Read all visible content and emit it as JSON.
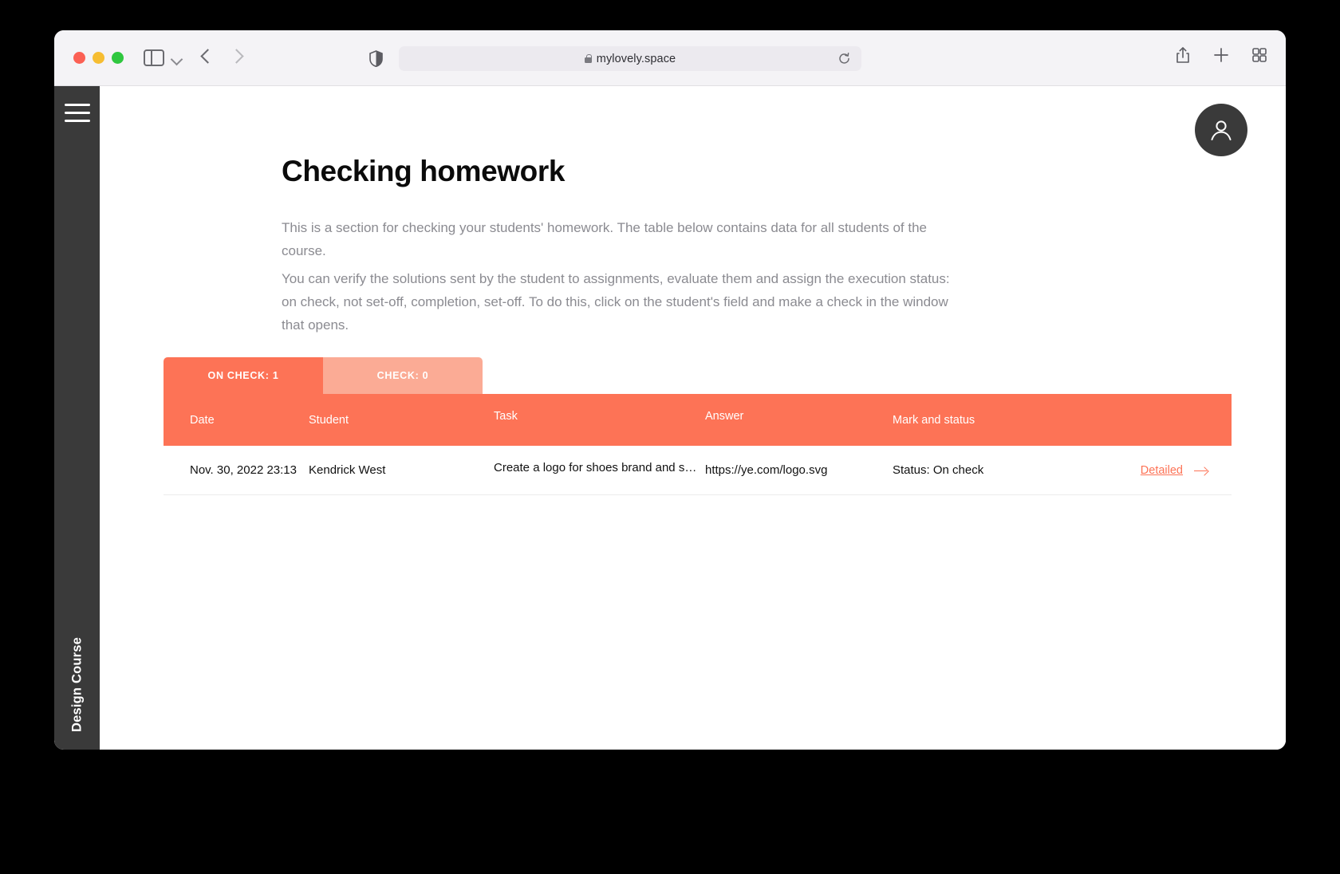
{
  "browser": {
    "url": "mylovely.space",
    "lock_icon": "lock-icon",
    "traffic_lights": [
      "close",
      "minimize",
      "zoom"
    ],
    "toolbar_icons": [
      "sidebar-icon",
      "chevron-down-icon",
      "back-arrow-icon",
      "forward-arrow-icon",
      "shield-icon",
      "reload-icon",
      "share-icon",
      "new-tab-icon",
      "tab-overview-icon"
    ]
  },
  "rail": {
    "menu_icon": "hamburger-menu-icon",
    "course_label": "Design Course"
  },
  "header": {
    "avatar_icon": "user-avatar-icon"
  },
  "main": {
    "title": "Checking homework",
    "paragraph_1": "This is a section for checking your students' homework. The table below contains data for all students of the course.",
    "paragraph_2": "You can verify the solutions sent by the student to assignments, evaluate them and assign the execution status: on check, not set-off, completion, set-off. To do this, click on the student's field and make a check in the window that opens."
  },
  "tabs": [
    {
      "label": "ON CHECK: 1",
      "active": true
    },
    {
      "label": "CHECK: 0",
      "active": false
    }
  ],
  "table": {
    "columns": [
      "Date",
      "Student",
      "Task",
      "Answer",
      "Mark and status",
      ""
    ],
    "rows": [
      {
        "date": "Nov. 30, 2022 23:13",
        "student": "Kendrick West",
        "task": "Create a logo for shoes brand and s…",
        "answer": "https://ye.com/logo.svg",
        "status": "Status: On check",
        "action": "Detailed",
        "action_icon": "arrow-right-icon"
      }
    ]
  },
  "colors": {
    "accent": "#fd7356",
    "accent_light": "#fbab95",
    "rail": "#3a3a3a",
    "muted_text": "#8b8b91"
  }
}
